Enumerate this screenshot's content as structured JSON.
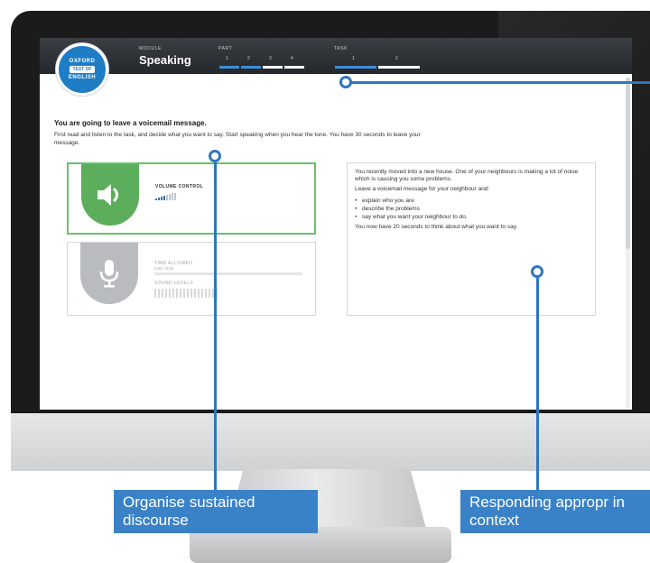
{
  "header": {
    "module_caption": "MODULE",
    "module_name": "Speaking",
    "part_caption": "PART",
    "part_steps": [
      "1",
      "2",
      "3",
      "4"
    ],
    "task_caption": "TASK",
    "task_steps": [
      "1",
      "2"
    ]
  },
  "logo": {
    "top": "OXFORD",
    "middle": "TEST OF",
    "bottom": "ENGLISH"
  },
  "instructions": {
    "title": "You are going to leave a voicemail message.",
    "body": "First read and listen to the task, and decide what you want to say. Start speaking when you hear the tone. You have 30 seconds to leave your message."
  },
  "volume_panel": {
    "label": "VOLUME CONTROL",
    "icon": "speaker-icon",
    "level_fraction": 0.5
  },
  "record_panel": {
    "time_label": "TIME ALLOWED",
    "time_value": "0:00 / 0:30",
    "sound_label": "SOUND LEVELS",
    "icon": "microphone-icon"
  },
  "task_panel": {
    "intro": "You recently moved into a new house. One of your neighbours is making a lot of noise which is causing you some problems.",
    "prompt": "Leave a voicemail message for your neighbour and:",
    "bullets": [
      "explain who you are",
      "describe the problems",
      "say what you want your neighbour to do."
    ],
    "footer": "You now have 20 seconds to think about what you want to say."
  },
  "callouts": {
    "left": "Organise sustained discourse",
    "right": "Responding appropr in context"
  },
  "colors": {
    "accent_blue": "#3a82c8",
    "volume_green": "#5dae5c",
    "header_dark": "#2b2e32"
  }
}
